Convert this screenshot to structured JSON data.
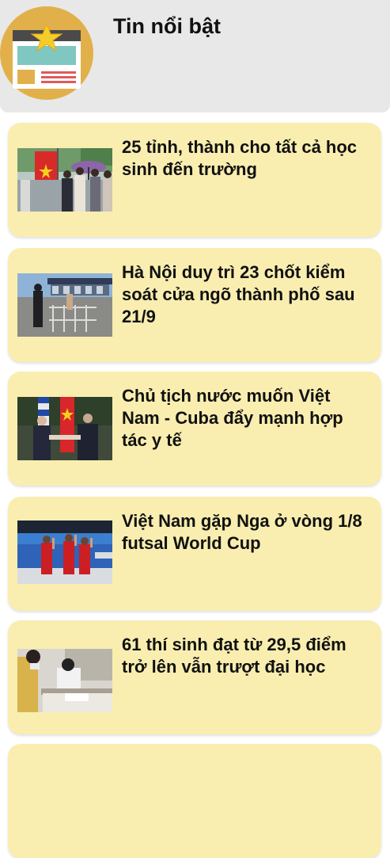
{
  "header": {
    "title": "Tin nổi bật",
    "icon": "featured-news-icon"
  },
  "colors": {
    "header_bg": "#e8e8e8",
    "card_bg": "#f9eeb0"
  },
  "articles": [
    {
      "title": "25 tỉnh, thành cho tất cả học sinh đến trường",
      "thumbnail": "students-with-flag-photo"
    },
    {
      "title": "Hà Nội duy trì 23 chốt kiểm soát cửa ngõ thành phố sau 21/9",
      "thumbnail": "checkpoint-photo"
    },
    {
      "title": "Chủ tịch nước muốn Việt Nam - Cuba đẩy mạnh hợp tác y tế",
      "thumbnail": "officials-meeting-photo"
    },
    {
      "title": "Việt Nam gặp Nga ở vòng 1/8 futsal World Cup",
      "thumbnail": "futsal-team-photo"
    },
    {
      "title": "61 thí sinh đạt từ 29,5 điểm trở lên vẫn trượt đại học",
      "thumbnail": "exam-room-photo"
    }
  ]
}
